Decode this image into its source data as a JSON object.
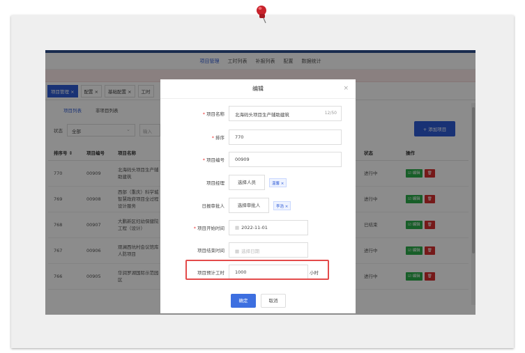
{
  "topnav": [
    "项目管理",
    "工时列表",
    "补报列表",
    "配置",
    "数据统计"
  ],
  "tabs": [
    {
      "label": "项目管理 ×",
      "active": true
    },
    {
      "label": "配置 ×",
      "active": false
    },
    {
      "label": "基础配置 ×",
      "active": false
    },
    {
      "label": "工时",
      "active": false
    }
  ],
  "subtabs": [
    "项目列表",
    "非项目列表"
  ],
  "filter": {
    "status_label": "状态",
    "status_value": "全部",
    "second_placeholder": "输入"
  },
  "add_button": "+ 添加项目",
  "table": {
    "headers": [
      "排序号 ⇕",
      "项目编号",
      "项目名称",
      "",
      "状态",
      "操作"
    ],
    "rows": [
      {
        "sort": "770",
        "code": "00909",
        "name": "北海码头项目生产辅助建筑",
        "status": "进行中"
      },
      {
        "sort": "769",
        "code": "00908",
        "name": "西部（重庆）科学城智慧政府项目全过程设计服务",
        "status": "进行中"
      },
      {
        "sort": "768",
        "code": "00907",
        "name": "大鹏新区妇幼保健院工程（设计）",
        "status": "已结束"
      },
      {
        "sort": "767",
        "code": "00906",
        "name": "观澜西坑村会议馆库人防项目",
        "status": "进行中"
      },
      {
        "sort": "766",
        "code": "00905",
        "name": "华润罗湖国际示范园区",
        "status": "进行中"
      }
    ],
    "edit_label": "☑ 编辑",
    "delete_label": "🗑"
  },
  "dialog": {
    "title": "编辑",
    "close": "×",
    "fields": {
      "name": {
        "label": "项目名称",
        "value": "北海码头项目生产辅助建筑",
        "counter": "12/50"
      },
      "sort": {
        "label": "排序",
        "value": "770"
      },
      "code": {
        "label": "项目编号",
        "value": "00909"
      },
      "manager": {
        "label": "项目经理",
        "button": "选择人员",
        "tag": "温馨 ×"
      },
      "approver": {
        "label": "日报审批人",
        "button": "选择审批人",
        "tag": "李浩 ×"
      },
      "start": {
        "label": "项目开始时间",
        "value": "2022-11-01"
      },
      "end": {
        "label": "项目结束时间",
        "placeholder": "选择日期"
      },
      "hours": {
        "label": "项目预计工时",
        "value": "1000",
        "unit": "小时"
      }
    },
    "ok": "确定",
    "cancel": "取消"
  },
  "colors": {
    "accent": "#2f5bd6",
    "highlight": "#e34a4a",
    "edit": "#2bab4a",
    "delete": "#d62e2e"
  }
}
